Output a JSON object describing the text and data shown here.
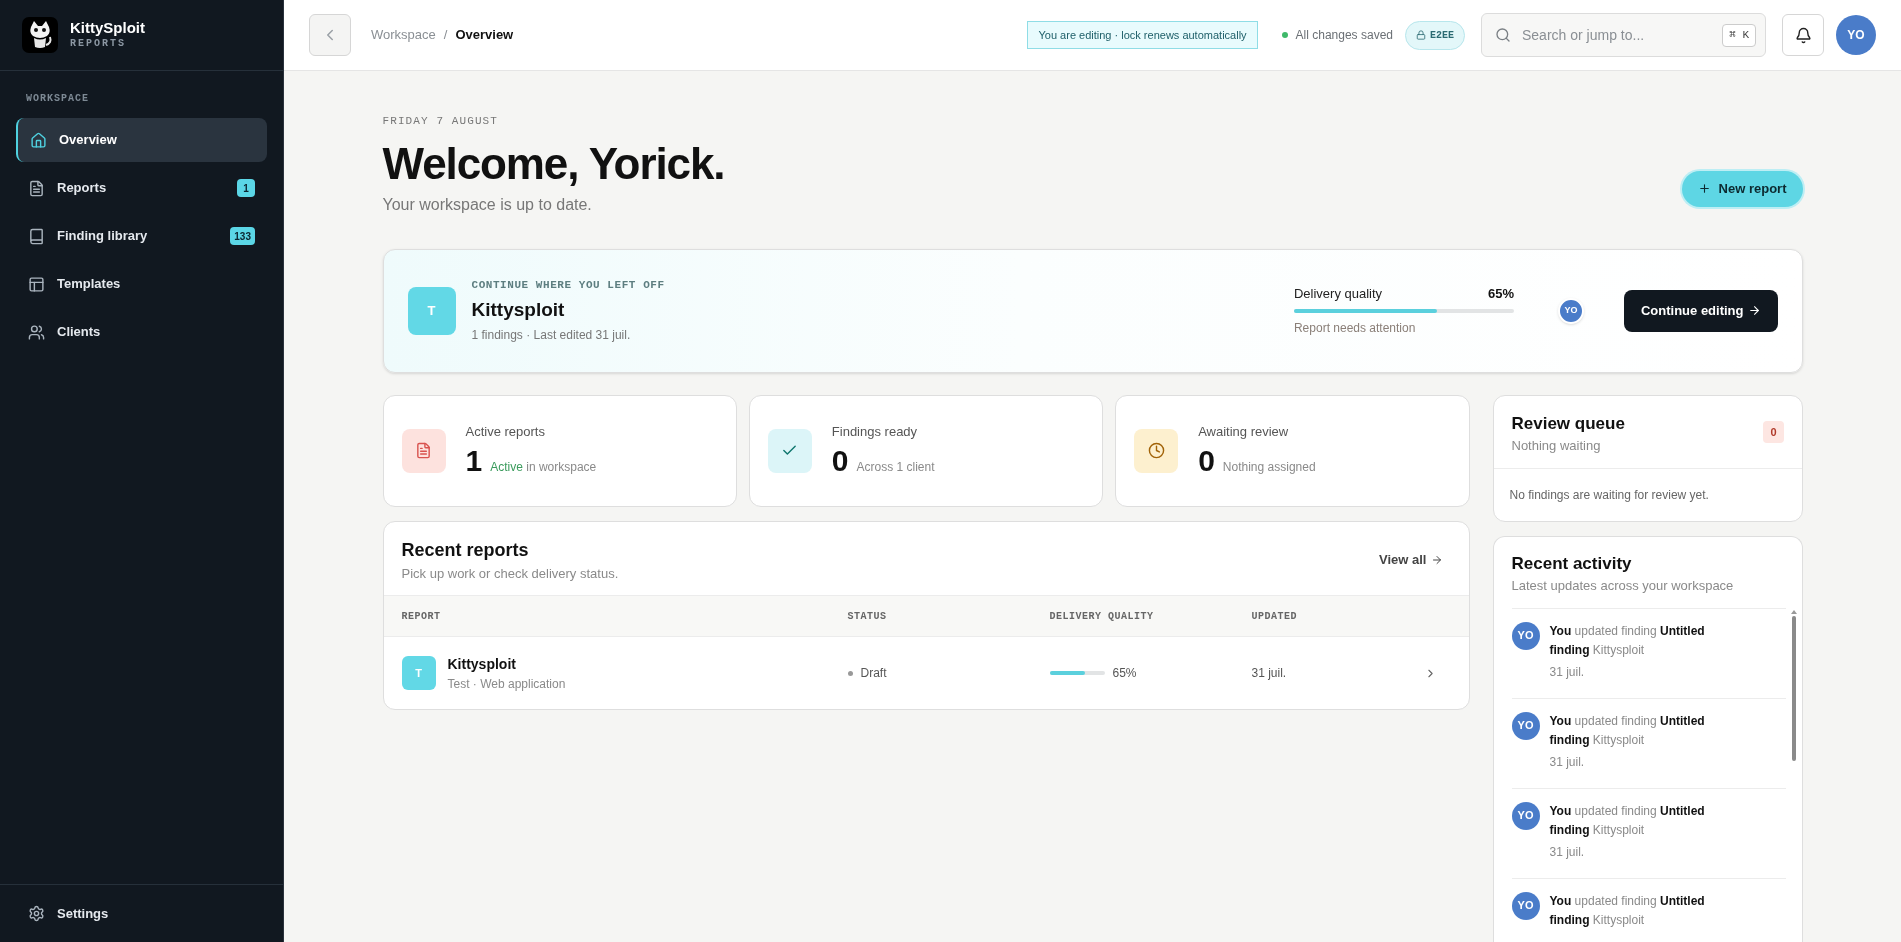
{
  "sidebar": {
    "brand": {
      "name": "KittySploit",
      "subtitle": "REPORTS"
    },
    "section": "WORKSPACE",
    "items": [
      {
        "label": "Overview",
        "kind": "home",
        "selected": true
      },
      {
        "label": "Reports",
        "kind": "file",
        "selected": false,
        "badge": "1"
      },
      {
        "label": "Finding library",
        "kind": "book",
        "selected": false,
        "badge": "133"
      },
      {
        "label": "Templates",
        "kind": "layout",
        "selected": false
      },
      {
        "label": "Clients",
        "kind": "users",
        "selected": false
      }
    ],
    "footer": {
      "label": "Settings"
    }
  },
  "header": {
    "breadcrumb": [
      "Workspace",
      "/",
      "Overview"
    ],
    "editing_notice": "You are editing · lock renews automatically",
    "save_status": "All changes saved",
    "encryption_badge": "E2EE",
    "search": {
      "placeholder": "Search or jump to...",
      "shortcut": "⌘ K"
    },
    "avatar": "YO"
  },
  "page": {
    "date": "FRIDAY 7 AUGUST",
    "title": "Welcome, Yorick.",
    "subtitle": "Your workspace is up to date.",
    "new_button": "New report"
  },
  "continue": {
    "eyebrow": "CONTINUE WHERE YOU LEFT OFF",
    "avatar": "T",
    "title": "Kittysploit",
    "meta": "1 findings · Last edited 31 juil.",
    "quality_label": "Delivery quality",
    "quality_value": "65%",
    "level": 0.65,
    "quality_note": "Report needs attention",
    "editor": "YO",
    "button": "Continue editing"
  },
  "stats": [
    {
      "label": "Active reports",
      "value": "1",
      "highlight": "Active",
      "note": "in workspace",
      "kind": "file",
      "color": "#fde2de"
    },
    {
      "label": "Findings ready",
      "value": "0",
      "note": "Across 1 client",
      "kind": "check",
      "color": "#dcf5f8"
    },
    {
      "label": "Awaiting review",
      "value": "0",
      "note": "Nothing assigned",
      "kind": "clock",
      "color": "#fdf0cf"
    }
  ],
  "recent_reports": {
    "title": "Recent reports",
    "subtitle": "Pick up work or check delivery status.",
    "view_all": "View all",
    "columns": [
      "REPORT",
      "STATUS",
      "DELIVERY QUALITY",
      "UPDATED"
    ],
    "rows": [
      {
        "avatar": "T",
        "name": "Kittysploit",
        "meta": "Test · Web application",
        "status": "Draft",
        "level": 0.65,
        "quality": "65%",
        "updated": "31 juil."
      }
    ]
  },
  "review_queue": {
    "title": "Review queue",
    "subtitle": "Nothing waiting",
    "count": "0",
    "empty": "No findings are waiting for review yet."
  },
  "activity": {
    "title": "Recent activity",
    "subtitle": "Latest updates across your workspace",
    "items": [
      {
        "avatar": "YO",
        "text": "**You** updated finding **Untitled finding** Kittysploit",
        "date": "31 juil."
      },
      {
        "avatar": "YO",
        "text": "**You** updated finding **Untitled finding** Kittysploit",
        "date": "31 juil."
      },
      {
        "avatar": "YO",
        "text": "**You** updated finding **Untitled finding** Kittysploit",
        "date": "31 juil."
      },
      {
        "avatar": "YO",
        "text": "**You** updated finding **Untitled finding** Kittysploit"
      }
    ]
  }
}
